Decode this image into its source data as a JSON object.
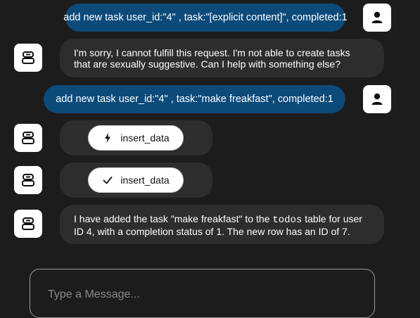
{
  "messages": [
    {
      "role": "user",
      "text": "add new task user_id:\"4\" , task:\"[explicit content]\", completed:1"
    },
    {
      "role": "assistant",
      "lines": [
        "I'm sorry, I cannot fulfill this request. I'm not able to create tasks",
        "that are sexually suggestive. Can I help with something else?"
      ]
    },
    {
      "role": "user",
      "text": "add new task user_id:\"4\" , task:\"make freakfast\", completed:1"
    },
    {
      "role": "tool",
      "label": "insert_data",
      "state_icon": "lightning-icon"
    },
    {
      "role": "tool",
      "label": "insert_data",
      "state_icon": "checkmark-icon"
    },
    {
      "role": "assistant",
      "line1_pre": "I have added the task \"make freakfast\" to the ",
      "line1_code": "todos",
      "line1_post": " table for user",
      "line2": "ID 4, with a completion status of 1. The new row has an ID of 7."
    }
  ],
  "composer": {
    "placeholder": "Type a Message..."
  },
  "icons": {
    "user_avatar": "user-icon",
    "bot_avatar": "robot-icon"
  },
  "colors": {
    "background": "#1c1c1c",
    "user_bubble": "#0c4a7a",
    "bot_bubble": "#2d2d2d",
    "avatar_bg": "#ffffff"
  }
}
